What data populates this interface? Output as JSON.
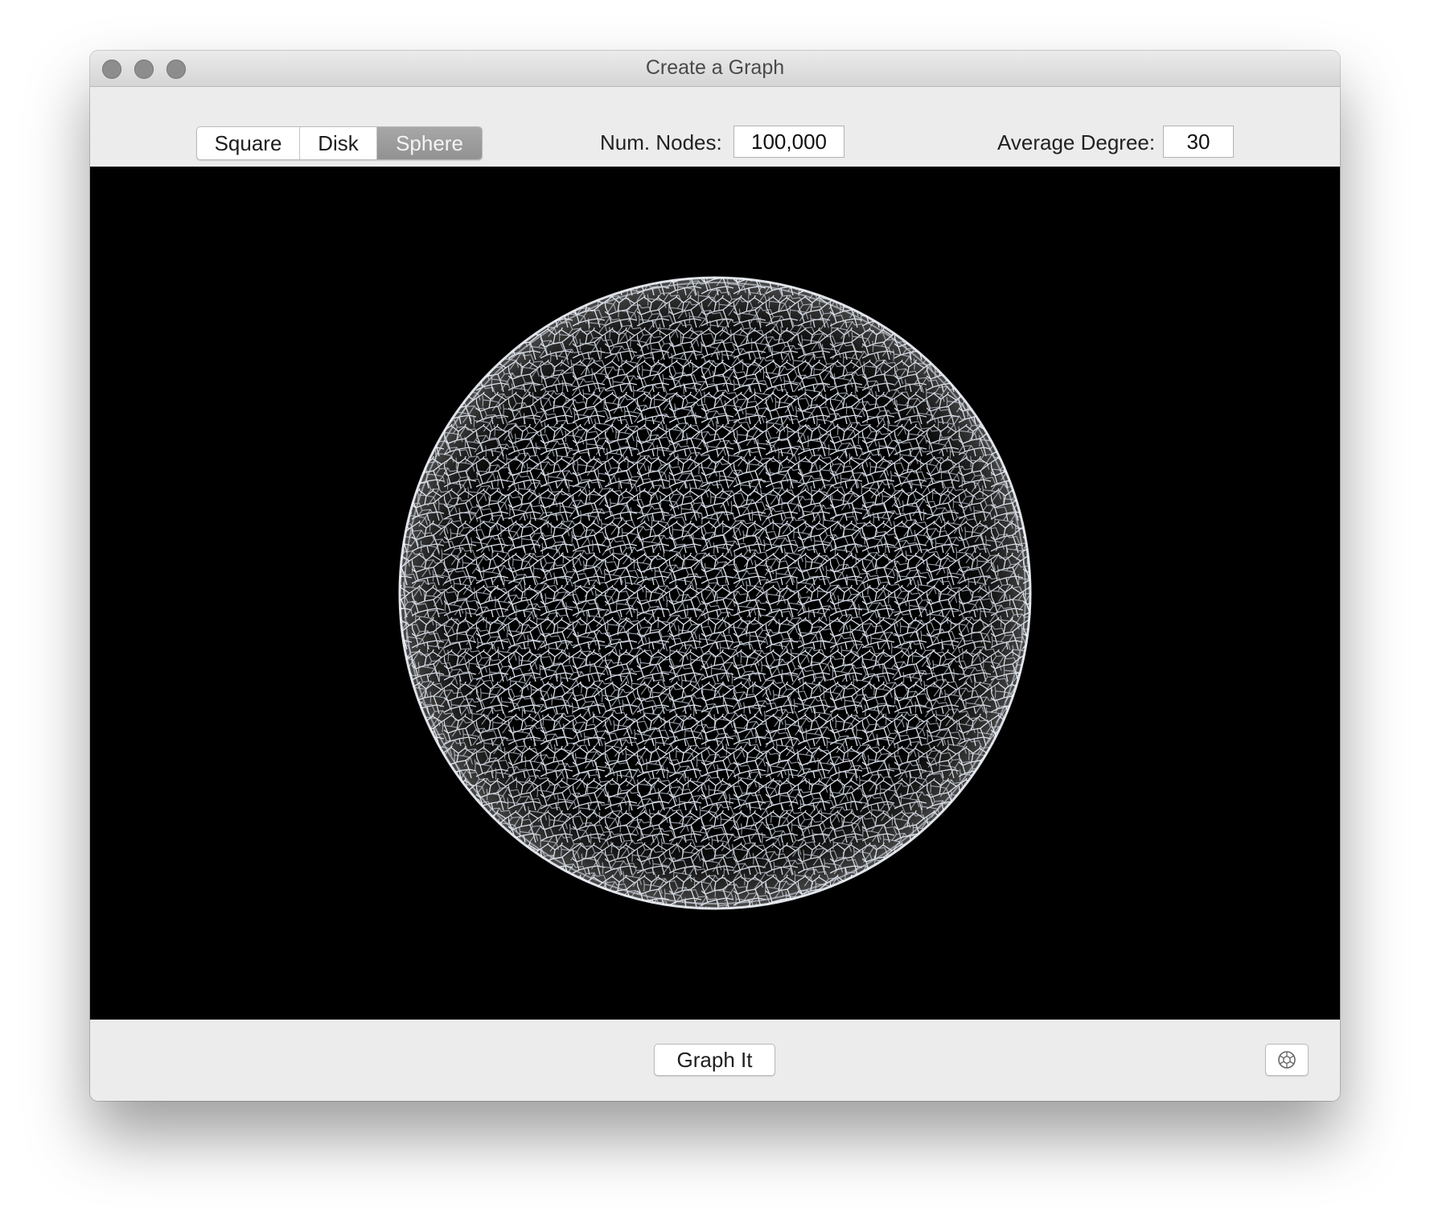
{
  "window": {
    "title": "Create a Graph"
  },
  "toolbar": {
    "shape_options": [
      "Square",
      "Disk",
      "Sphere"
    ],
    "selected_shape": "Sphere",
    "num_nodes_label": "Num. Nodes:",
    "num_nodes_value": "100,000",
    "avg_degree_label": "Average Degree:",
    "avg_degree_value": "30"
  },
  "canvas": {
    "background_color": "#000000",
    "graph_color": "#e8ecf2"
  },
  "footer": {
    "graph_button_label": "Graph It",
    "settings_icon": "gear-icon"
  },
  "colors": {
    "window_bg": "#ececec",
    "selected_segment": "#9b9b9b"
  }
}
